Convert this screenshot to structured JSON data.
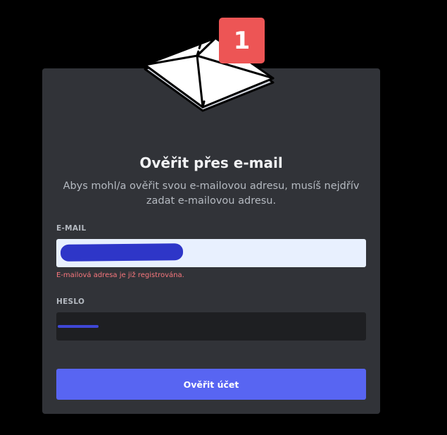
{
  "dialog": {
    "badge_number": "1",
    "title": "Ověřit přes e-mail",
    "subtitle": "Abys mohl/a ověřit svou e-mailovou adresu, musíš nejdřív zadat e-mailovou adresu.",
    "email": {
      "label": "E-MAIL",
      "value": "",
      "error": "E-mailová adresa je již registrována."
    },
    "password": {
      "label": "HESLO",
      "value": ""
    },
    "submit_label": "Ověřit účet"
  },
  "colors": {
    "modal_bg": "#313338",
    "accent": "#5865f2",
    "error": "#f8777d",
    "badge": "#ed5555"
  },
  "icons": {
    "illustration": "envelope-icon"
  }
}
